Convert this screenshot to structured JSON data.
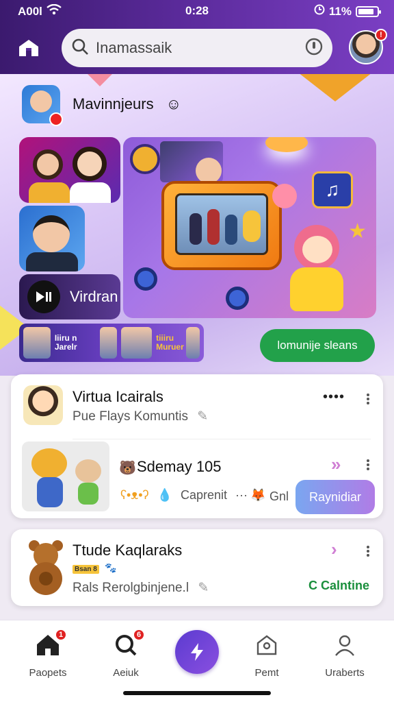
{
  "status": {
    "carrier": "A00l",
    "time": "0:28",
    "battery": "11%"
  },
  "header": {
    "search_text": "Inamassaik"
  },
  "hero": {
    "title": "Mavinnjeurs",
    "tile_label": "Virdran",
    "strip_text": "Iiiru n Jarelr",
    "strip_text2": "tiiiru Muruer",
    "cta_label": "lomunije sleans"
  },
  "card1": {
    "title": "Virtua Icairals",
    "subtitle": "Pue Flays Komuntis",
    "more": "••••",
    "row_title": "Sdemay 105",
    "meta_left": "Caprenit",
    "meta_ellipsis": "···",
    "meta_right": "Gnl",
    "button_label": "Raynidiar"
  },
  "card2": {
    "title": "Ttude Kaqlaraks",
    "tag": "Bsan 8",
    "subtitle": "Rals Rerolgbinjene.l",
    "link_label": "C Calntine"
  },
  "nav": {
    "items": [
      {
        "label": "Paopets",
        "badge": "1"
      },
      {
        "label": "Aeiuk",
        "badge": "6"
      },
      {
        "label": "Pemt"
      },
      {
        "label": "Uraberts"
      }
    ]
  },
  "colors": {
    "accent": "#6a3fc2",
    "green": "#22a14a",
    "badge": "#e02222"
  }
}
